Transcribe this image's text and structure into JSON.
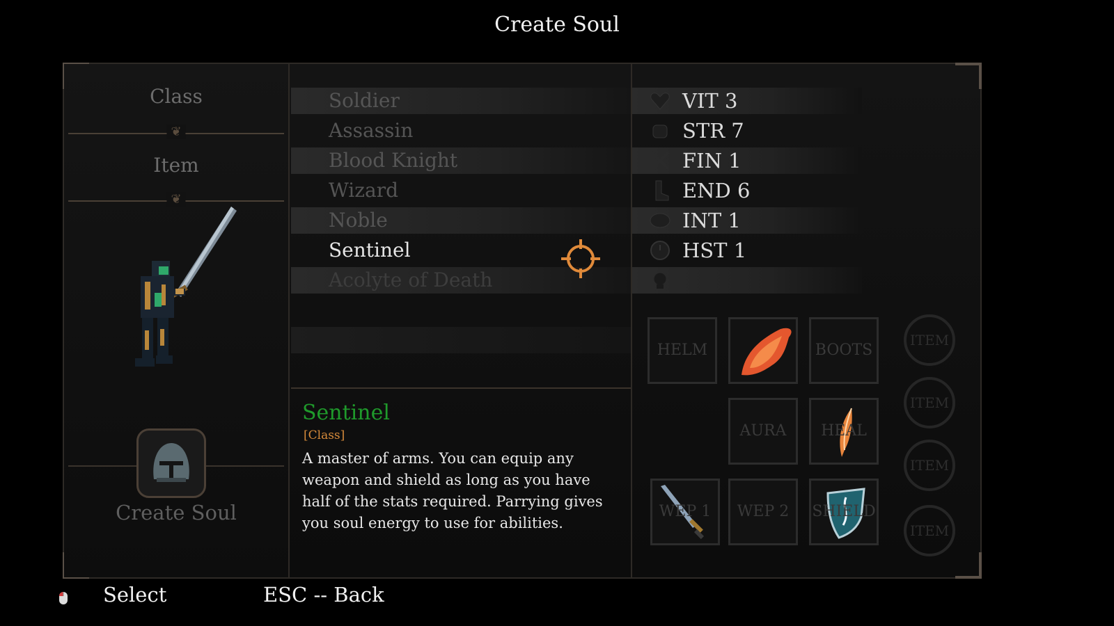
{
  "screen_title": "Create Soul",
  "left_panel": {
    "tabs": [
      "Class",
      "Item"
    ],
    "create_soul_label": "Create Soul"
  },
  "class_list": [
    {
      "name": "Soldier",
      "state": "normal"
    },
    {
      "name": "Assassin",
      "state": "normal"
    },
    {
      "name": "Blood Knight",
      "state": "normal"
    },
    {
      "name": "Wizard",
      "state": "normal"
    },
    {
      "name": "Noble",
      "state": "normal"
    },
    {
      "name": "Sentinel",
      "state": "selected"
    },
    {
      "name": "Acolyte of Death",
      "state": "locked"
    }
  ],
  "description": {
    "name": "Sentinel",
    "tag": "[Class]",
    "text": "A master of arms. You can equip any weapon and shield as long as you have half of the stats required. Parrying gives you soul energy to use for abilities.",
    "name_color": "#1f9a2b",
    "tag_color": "#d58a3a"
  },
  "stats": [
    {
      "label": "VIT 3",
      "icon": "heart-icon"
    },
    {
      "label": "STR 7",
      "icon": "fist-icon"
    },
    {
      "label": "FIN 1",
      "icon": "crossed-blades-icon"
    },
    {
      "label": "END 6",
      "icon": "boot-icon"
    },
    {
      "label": "INT 1",
      "icon": "brain-icon"
    },
    {
      "label": "HST 1",
      "icon": "clock-icon"
    },
    {
      "label": "",
      "icon": "skull-icon"
    }
  ],
  "equipment": {
    "helm": "HELM",
    "cape": "",
    "boots": "BOOTS",
    "aura": "AURA",
    "heal": "HEAL",
    "wep1": "WEP 1",
    "wep2": "WEP 2",
    "shield": "SHIELD"
  },
  "item_slots": [
    "ITEM",
    "ITEM",
    "ITEM",
    "ITEM"
  ],
  "hints": {
    "select": "Select",
    "back": "ESC -- Back"
  },
  "colors": {
    "accent_orange": "#e08a3a",
    "frame": "#2e2a26"
  }
}
